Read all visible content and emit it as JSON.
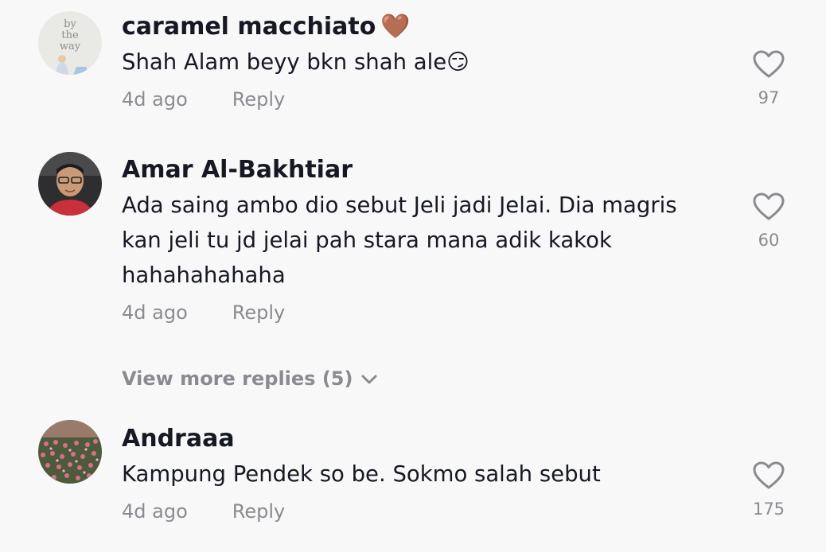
{
  "comments": [
    {
      "username": "caramel macchiato",
      "username_emoji": "🤎",
      "text": "Shah Alam beyy bkn shah ale😏",
      "time": "4d ago",
      "reply_label": "Reply",
      "likes": "97",
      "avatar_text": [
        "by",
        "the",
        "way"
      ]
    },
    {
      "username": "Amar Al-Bakhtiar",
      "text_lines": [
        "Ada saing ambo dio sebut Jeli jadi Jelai. Dia magris",
        "kan jeli tu jd jelai pah stara mana adik kakok",
        "hahahahahaha"
      ],
      "time": "4d ago",
      "reply_label": "Reply",
      "likes": "60"
    },
    {
      "username": "Andraaa",
      "text": "Kampung Pendek so be. Sokmo salah sebut",
      "time": "4d ago",
      "reply_label": "Reply",
      "likes": "175"
    }
  ],
  "view_more_replies": "View more replies (5)",
  "colors": {
    "background": "#f8f8f8",
    "text": "#161823",
    "muted": "#8a8b91"
  }
}
